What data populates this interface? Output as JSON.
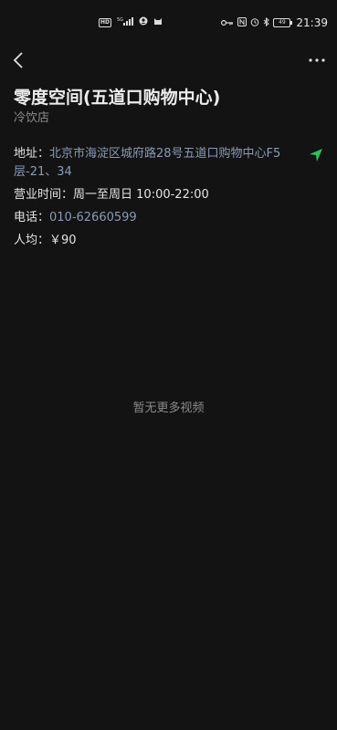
{
  "status_bar": {
    "hd": "HD",
    "net": "5G",
    "time": "21:39",
    "battery": "49"
  },
  "shop": {
    "title": "零度空间(五道口购物中心)",
    "category": "冷饮店"
  },
  "info": {
    "address_label": "地址：",
    "address": "北京市海淀区城府路28号五道口购物中心F5层-21、34",
    "hours_label": "营业时间：",
    "hours": "周一至周日 10:00-22:00",
    "phone_label": "电话：",
    "phone": "010-62660599",
    "avg_label": "人均：",
    "avg": "￥90"
  },
  "empty_message": "暂无更多视频",
  "colors": {
    "background": "#131313",
    "link": "#8a9ab6",
    "nav_arrow": "#2fbf5a"
  }
}
